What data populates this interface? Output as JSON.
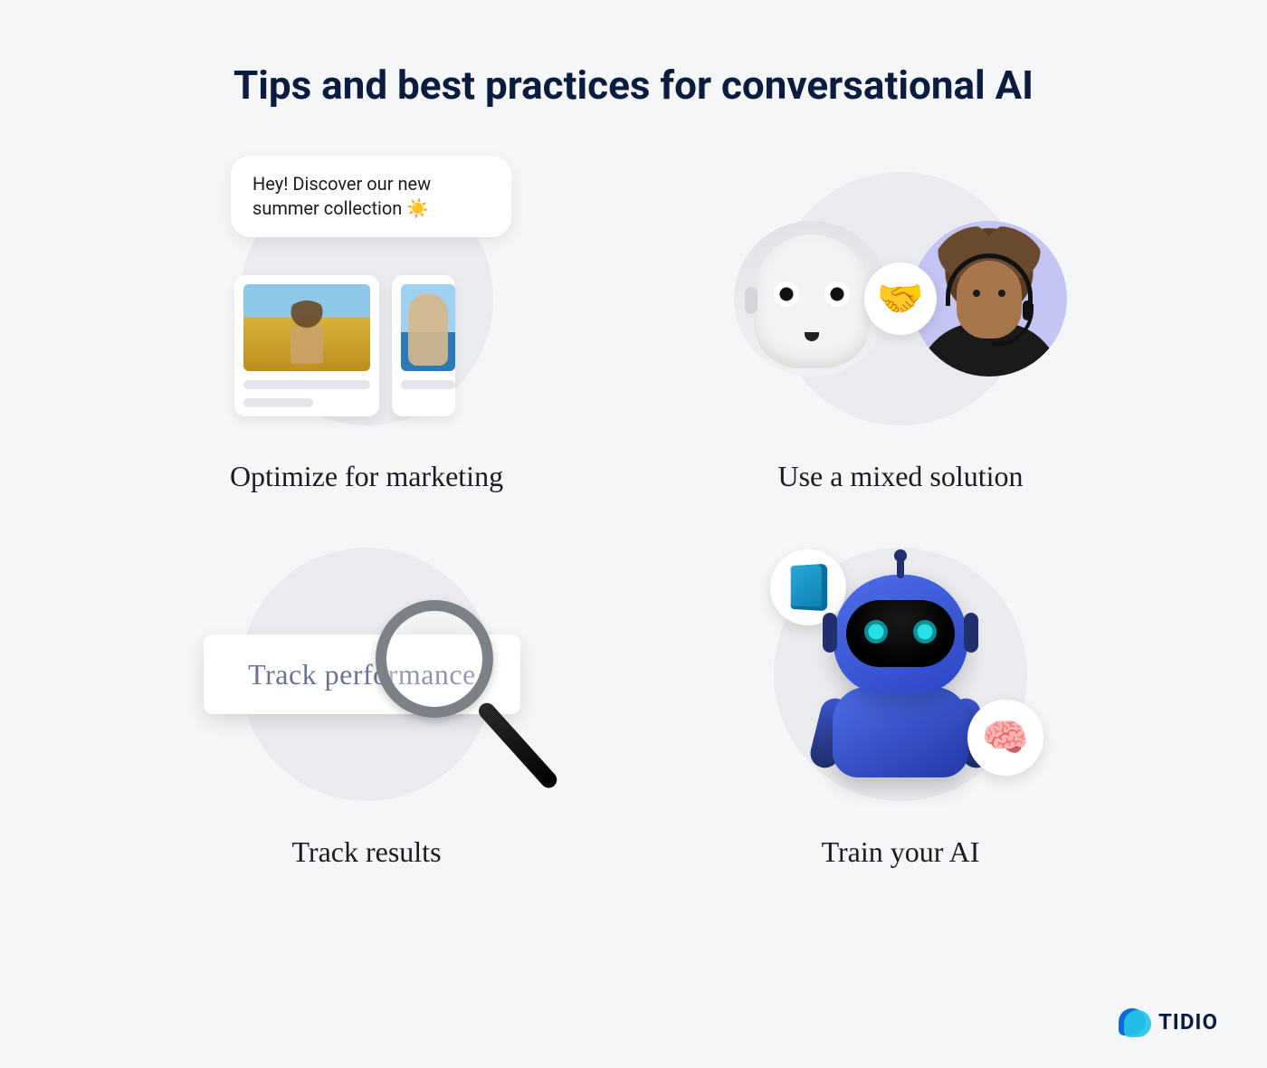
{
  "title": "Tips and best practices for conversational AI",
  "tips": [
    {
      "caption": "Optimize for marketing",
      "chat_message": "Hey! Discover our new summer collection ☀️"
    },
    {
      "caption": "Use a mixed solution",
      "handshake_emoji": "🤝"
    },
    {
      "caption": "Track results",
      "card_label": "Track performance"
    },
    {
      "caption": "Train your AI",
      "brain_emoji": "🧠"
    }
  ],
  "logo_text": "TIDIO"
}
